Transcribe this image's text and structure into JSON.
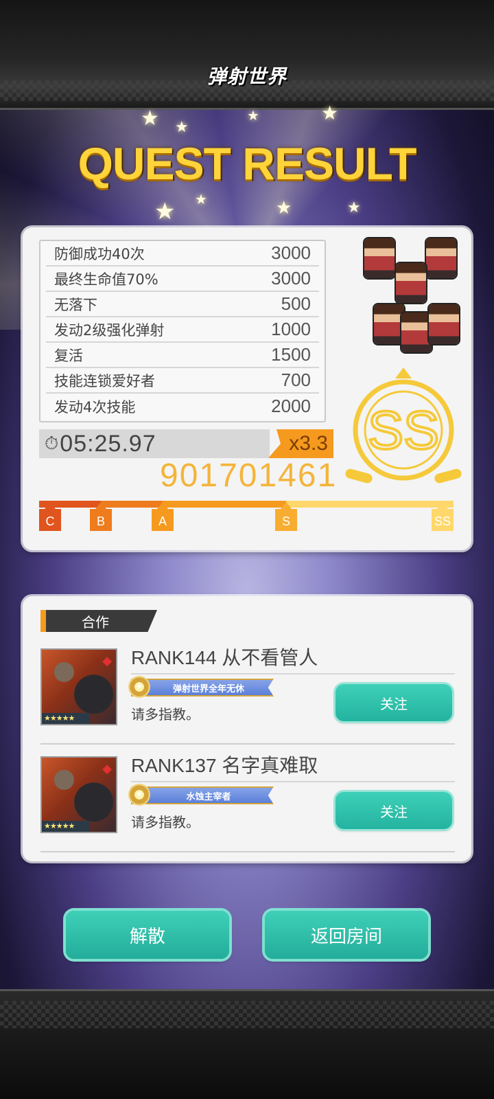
{
  "header": {
    "logo_text": "弹射世界"
  },
  "title": "QUEST RESULT",
  "missions": [
    {
      "name": "防御成功40次",
      "points": "3000"
    },
    {
      "name": "最终生命值70%",
      "points": "3000"
    },
    {
      "name": "无落下",
      "points": "500"
    },
    {
      "name": "发动2级强化弹射",
      "points": "1000"
    },
    {
      "name": "复活",
      "points": "1500"
    },
    {
      "name": "技能连锁爱好者",
      "points": "700"
    },
    {
      "name": "发动4次技能",
      "points": "2000"
    }
  ],
  "clear_time": "05:25.97",
  "multiplier": "x3.3",
  "score": "901701461",
  "grade": "SS",
  "grade_color": "#f5c93a",
  "rank_progress": 1.0,
  "rank_marks": [
    "C",
    "B",
    "A",
    "S",
    "SS"
  ],
  "coop": {
    "tab_label": "合作",
    "players": [
      {
        "rank_name": "RANK144 从不看管人",
        "title_badge": "弹射世界全年无休",
        "greeting": "请多指教。",
        "stars": "★★★★★",
        "follow_label": "关注"
      },
      {
        "rank_name": "RANK137 名字真难取",
        "title_badge": "水蚀主宰者",
        "greeting": "请多指教。",
        "stars": "★★★★★",
        "follow_label": "关注"
      }
    ]
  },
  "buttons": {
    "disband": "解散",
    "return_room": "返回房间"
  },
  "colors": {
    "accent_orange": "#f59a1f",
    "teal": "#2fc0aa",
    "gold": "#ffd43a"
  }
}
